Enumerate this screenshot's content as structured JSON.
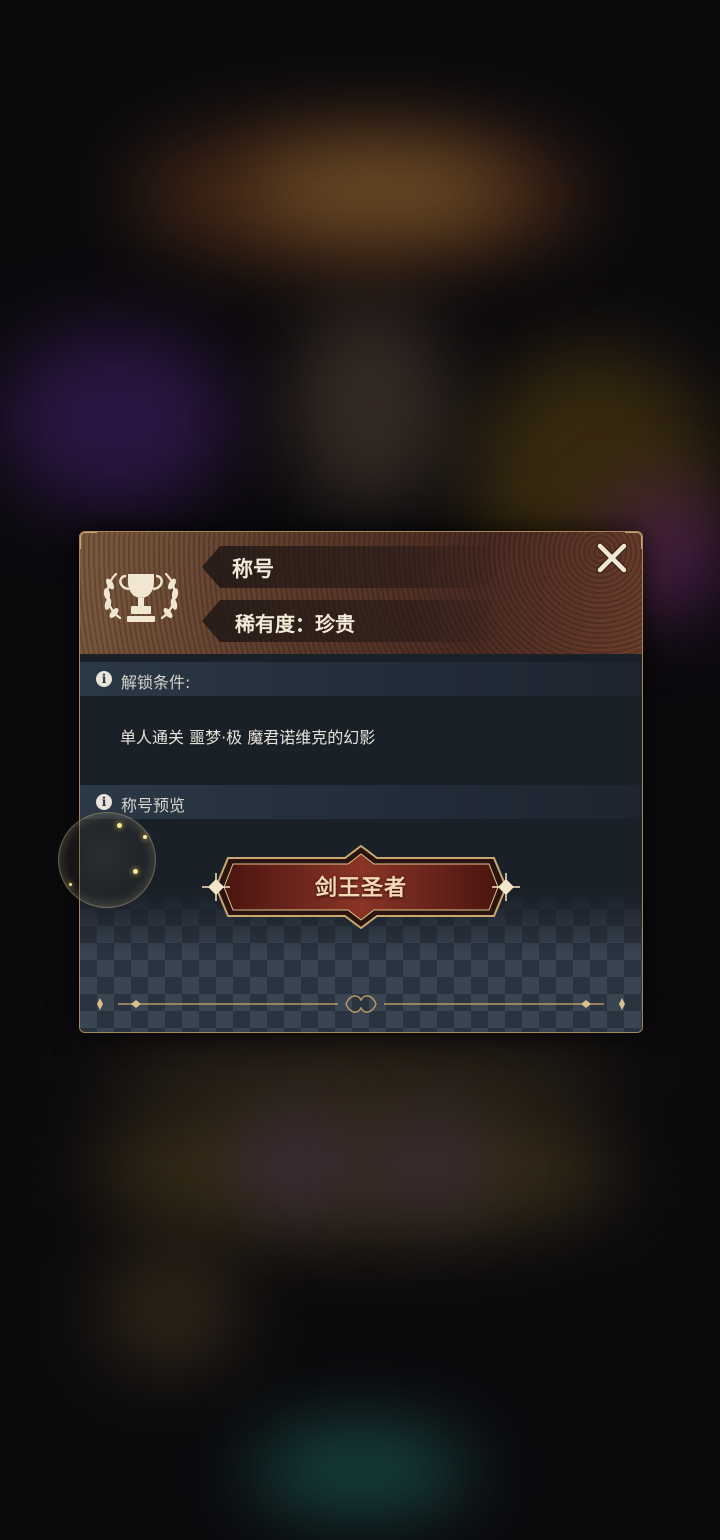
{
  "dialog": {
    "header": {
      "title": "称号",
      "rarity": "稀有度：珍贵",
      "trophy_icon": "trophy-laurel-icon",
      "close_icon": "close-x-icon"
    },
    "unlock_section": {
      "label": "解锁条件:",
      "condition": "单人通关 噩梦·极 魔君诺维克的幻影"
    },
    "preview_section": {
      "label": "称号预览",
      "title_name": "剑王圣者"
    }
  },
  "colors": {
    "accent_gold": "#c9a870",
    "header_brown": "#5c3a2b",
    "badge_red": "#7a2a1f",
    "panel_bg": "#1a2028"
  }
}
